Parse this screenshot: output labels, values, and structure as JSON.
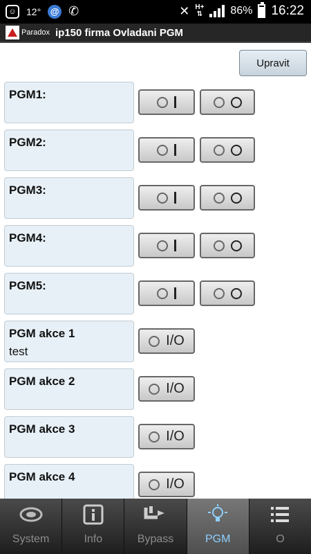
{
  "status_bar": {
    "temperature": "12°",
    "battery_percent": "86%",
    "network_type": "H+",
    "time": "16:22"
  },
  "titlebar": {
    "logo_text": "Paradox",
    "title": "ip150 firma Ovladani PGM"
  },
  "edit_button_label": "Upravit",
  "rows": [
    {
      "label": "PGM1:",
      "sub": ""
    },
    {
      "label": "PGM2:",
      "sub": ""
    },
    {
      "label": "PGM3:",
      "sub": ""
    },
    {
      "label": "PGM4:",
      "sub": ""
    },
    {
      "label": "PGM5:",
      "sub": ""
    },
    {
      "label": "PGM akce 1",
      "sub": "test"
    },
    {
      "label": "PGM akce 2",
      "sub": ""
    },
    {
      "label": "PGM akce 3",
      "sub": ""
    },
    {
      "label": "PGM akce 4",
      "sub": ""
    }
  ],
  "io_text": "I/O",
  "nav": [
    {
      "label": "System",
      "icon": "system-icon",
      "active": false
    },
    {
      "label": "Info",
      "icon": "info-icon",
      "active": false
    },
    {
      "label": "Bypass",
      "icon": "bypass-icon",
      "active": false
    },
    {
      "label": "PGM",
      "icon": "bulb-icon",
      "active": true
    },
    {
      "label": "O",
      "icon": "list-icon",
      "active": false
    }
  ],
  "colors": {
    "label_bg": "#e7f0f6",
    "active_nav_text": "#8fd0ff",
    "logo_red": "#c81e1e"
  }
}
